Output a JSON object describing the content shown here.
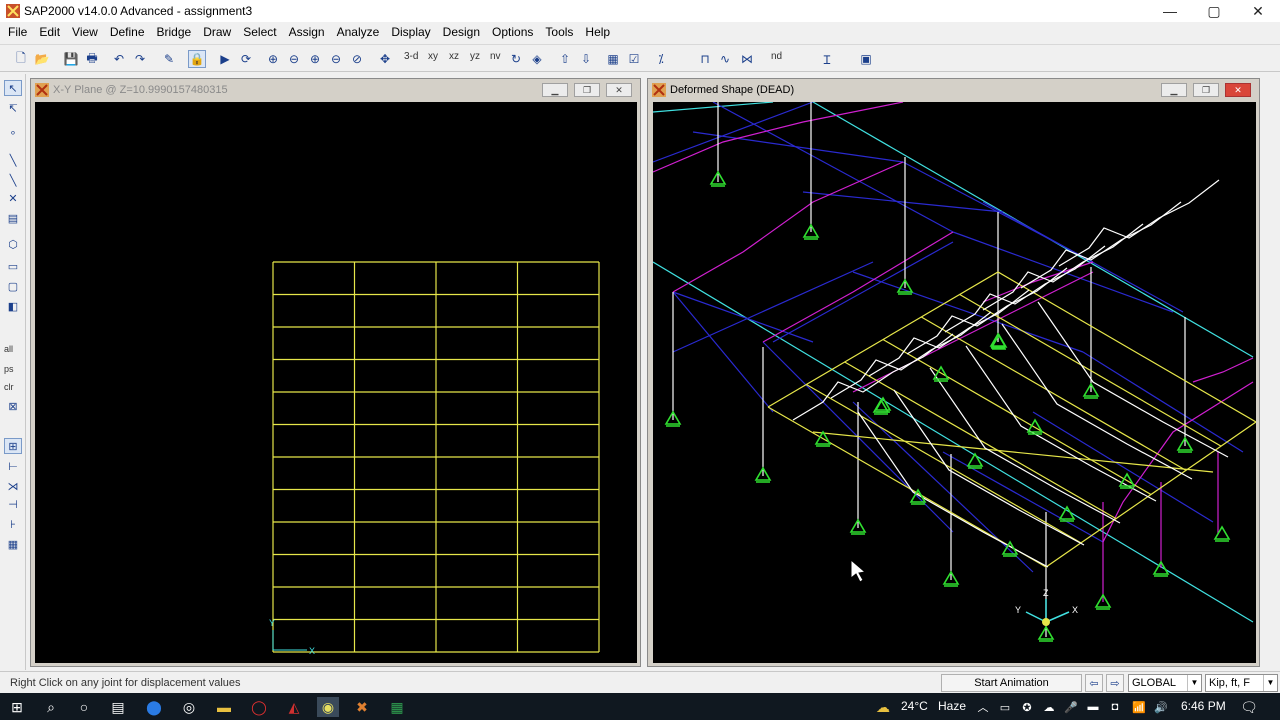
{
  "app": {
    "title": "SAP2000 v14.0.0 Advanced  -  assignment3",
    "controls": {
      "minimize": "—",
      "maximize": "▢",
      "close": "✕"
    }
  },
  "menu": [
    "File",
    "Edit",
    "View",
    "Define",
    "Bridge",
    "Draw",
    "Select",
    "Assign",
    "Analyze",
    "Display",
    "Design",
    "Options",
    "Tools",
    "Help"
  ],
  "toolbar": {
    "view_labels": [
      "3-d",
      "xy",
      "xz",
      "yz",
      "nv"
    ],
    "nd_label": "nd"
  },
  "left_toolbar": {
    "labels": [
      "all",
      "ps",
      "clr"
    ]
  },
  "windows": {
    "left": {
      "title": "X-Y Plane @ Z=10.9990157480315",
      "axis_y": "Y",
      "axis_x": "X"
    },
    "right": {
      "title": "Deformed Shape (DEAD)",
      "axis_x": "X",
      "axis_y": "Y",
      "axis_z": "Z"
    }
  },
  "status": {
    "hint": "Right Click on any joint for displacement values",
    "animation_button": "Start Animation",
    "coord_system": "GLOBAL",
    "units": "Kip, ft, F"
  },
  "taskbar": {
    "weather_temp": "24°C",
    "weather_desc": "Haze",
    "time": "6:46 PM"
  },
  "colors": {
    "grid": "#e6e64a",
    "frame_blue": "#2a2ad0",
    "frame_magenta": "#d020d0",
    "frame_cyan": "#40e0e0",
    "frame_white": "#ffffff",
    "support_green": "#30e030"
  }
}
